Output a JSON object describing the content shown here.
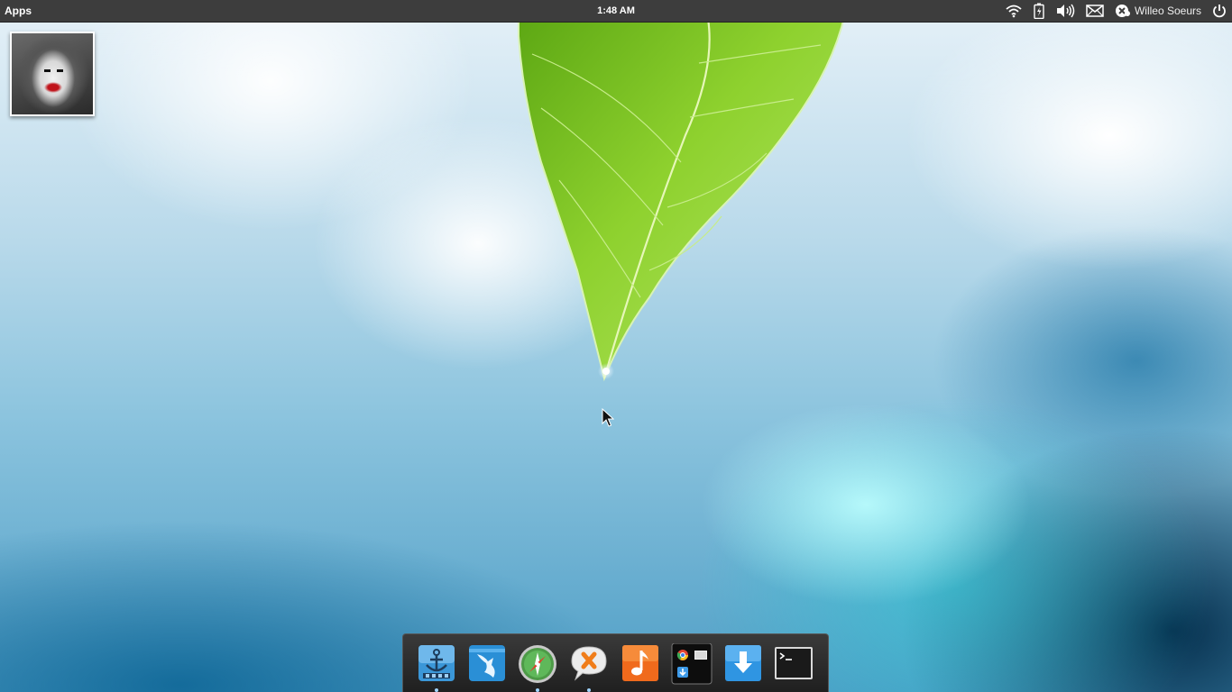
{
  "panel": {
    "apps_label": "Apps",
    "clock": "1:48 AM",
    "user_name": "Willeo Soeurs",
    "indicators": [
      "wifi-icon",
      "battery-icon",
      "volume-icon",
      "mail-icon",
      "user-icon",
      "power-icon"
    ]
  },
  "desktop": {
    "widget": "album-art",
    "wallpaper": "green-leaf-with-water-drop"
  },
  "dock": {
    "items": [
      {
        "name": "anchor-app-icon",
        "running": true
      },
      {
        "name": "shark-app-icon",
        "running": false
      },
      {
        "name": "compass-browser-icon",
        "running": true
      },
      {
        "name": "chat-app-icon",
        "running": true
      },
      {
        "name": "music-app-icon",
        "running": false
      },
      {
        "name": "app-launcher-icon",
        "running": false
      },
      {
        "name": "download-icon",
        "running": false
      },
      {
        "name": "terminal-icon",
        "running": false
      }
    ]
  },
  "colors": {
    "panel_bg": "#3d3d3d",
    "dock_bg": "#2a2a2a",
    "leaf_green": "#7cc423"
  }
}
